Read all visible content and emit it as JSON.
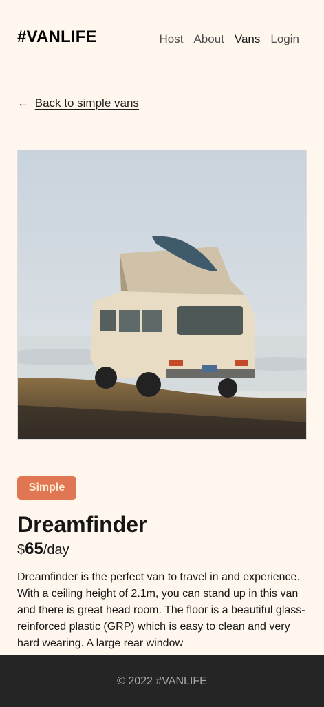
{
  "header": {
    "logo": "#VANLIFE",
    "nav": [
      {
        "label": "Host"
      },
      {
        "label": "About"
      },
      {
        "label": "Vans",
        "active": true
      },
      {
        "label": "Login"
      }
    ]
  },
  "back_link": {
    "arrow": "←",
    "label": "Back to simple vans"
  },
  "van": {
    "badge": "Simple",
    "badge_color": "#E17654",
    "name": "Dreamfinder",
    "price_currency": "$",
    "price_amount": "65",
    "price_unit": "/day",
    "description": "Dreamfinder is the perfect van to travel in and experience. With a ceiling height of 2.1m, you can stand up in this van and there is great head room. The floor is a beautiful glass-reinforced plastic (GRP) which is easy to clean and very hard wearing. A large rear window"
  },
  "footer": {
    "text": "© 2022 #VANLIFE"
  },
  "colors": {
    "background": "#FFF7ED",
    "accent": "#E17654",
    "footer": "#252525"
  }
}
